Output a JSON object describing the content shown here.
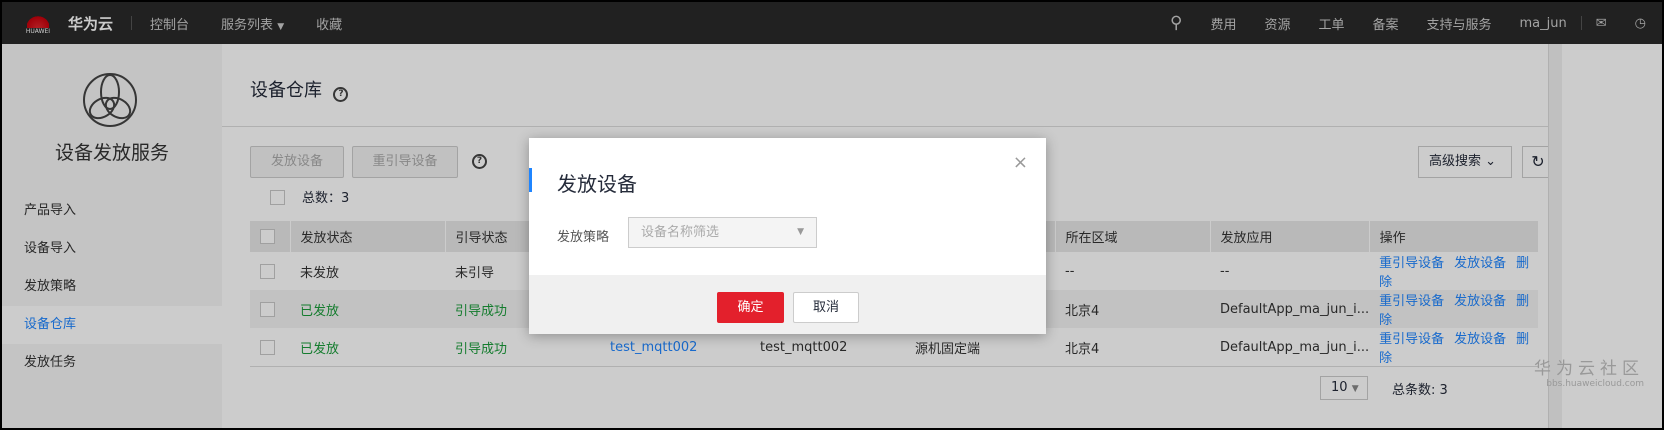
{
  "topbar": {
    "logo_text": "HUAWEI",
    "brand": "华为云",
    "nav": [
      "控制台",
      "服务列表",
      "收藏"
    ],
    "right": [
      "费用",
      "资源",
      "工单",
      "备案",
      "支持与服务"
    ],
    "user": "ma_jun"
  },
  "sidebar": {
    "service_title": "设备发放服务",
    "items": [
      "产品导入",
      "设备导入",
      "发放策略",
      "设备仓库",
      "发放任务"
    ],
    "active": "设备仓库"
  },
  "main": {
    "title": "设备仓库",
    "help": "?",
    "buttons": {
      "issue": "发放设备",
      "reboot": "重引导设备"
    },
    "total": "总数：3",
    "advanced_search": "高级搜索",
    "table": {
      "headers": [
        "发放状态",
        "引导状态",
        "",
        "",
        "",
        "所在区域",
        "发放应用",
        "操作"
      ],
      "rows": [
        {
          "issue": "未发放",
          "boot": "未引导",
          "c3": "",
          "c4": "",
          "c5": "",
          "region": "--",
          "app": "--",
          "green": false
        },
        {
          "issue": "已发放",
          "boot": "引导成功",
          "c3": "",
          "c4": "",
          "c5": "",
          "region": "北京4",
          "app": "DefaultApp_ma_jun_i...",
          "green": true
        },
        {
          "issue": "已发放",
          "boot": "引导成功",
          "c3": "test_mqtt002",
          "c4": "test_mqtt002",
          "c5": "源机固定端",
          "region": "北京4",
          "app": "DefaultApp_ma_jun_i...",
          "green": true
        }
      ],
      "actions": [
        "重引导设备",
        "发放设备",
        "删除"
      ]
    },
    "pagination": {
      "page_size": "10",
      "total": "总条数: 3"
    }
  },
  "modal": {
    "title": "发放设备",
    "close": "×",
    "label": "发放策略",
    "placeholder": "设备名称筛选",
    "ok": "确定",
    "cancel": "取消"
  },
  "watermark": {
    "line1": "华为云社区",
    "line2": "bbs.huaweicloud.com"
  }
}
